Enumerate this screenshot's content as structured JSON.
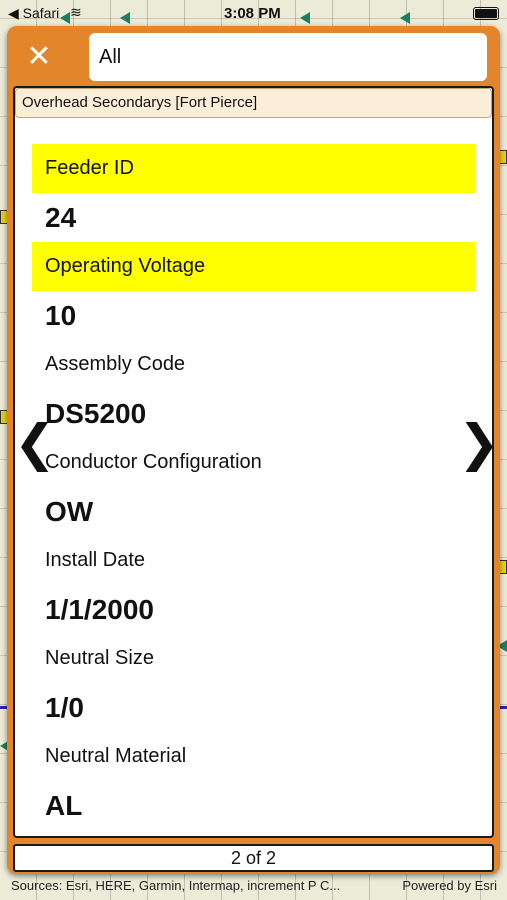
{
  "status_bar": {
    "back_label": "◀ Safari",
    "time": "3:08 PM"
  },
  "search": {
    "value": "All"
  },
  "popup": {
    "layer_title": "Overhead Secondarys [Fort Pierce]",
    "fields": [
      {
        "label": "Feeder ID",
        "value": "24",
        "highlighted": true
      },
      {
        "label": "Operating Voltage",
        "value": "10",
        "highlighted": true
      },
      {
        "label": "Assembly Code",
        "value": "DS5200",
        "highlighted": false
      },
      {
        "label": "Conductor Configuration",
        "value": "OW",
        "highlighted": false
      },
      {
        "label": "Install Date",
        "value": "1/1/2000",
        "highlighted": false
      },
      {
        "label": "Neutral Size",
        "value": "1/0",
        "highlighted": false
      },
      {
        "label": "Neutral Material",
        "value": "AL",
        "highlighted": false
      }
    ],
    "prev_glyph": "❮",
    "next_glyph": "❯",
    "close_glyph": "✕",
    "pager": "2 of 2"
  },
  "attribution": {
    "sources": "Sources: Esri, HERE, Garmin, Intermap, increment P C...",
    "powered_by": "Powered by Esri"
  },
  "colors": {
    "header": "#e3852a",
    "highlight": "#ffff00",
    "layer_title_bg": "#fbeed8"
  }
}
